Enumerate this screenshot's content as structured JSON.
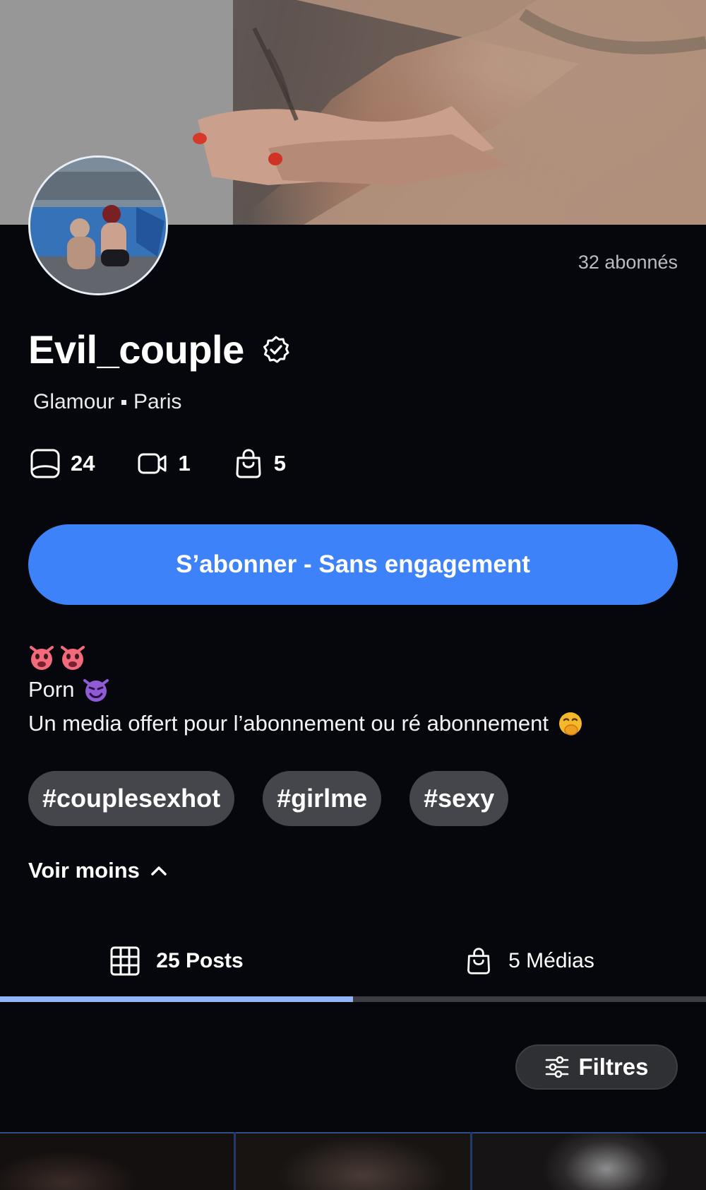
{
  "profile": {
    "subscribers": "32 abonnés",
    "name": "Evil_couple",
    "category": "Glamour",
    "location": "Paris",
    "verified": true
  },
  "stats": {
    "photos": "24",
    "videos": "1",
    "shop": "5"
  },
  "subscribe_button": {
    "label": "S’abonner - Sans engagement"
  },
  "bio": {
    "line2_text": "Porn",
    "line3_text": "Un media offert pour l’abonnement ou ré abonnement"
  },
  "tags": [
    "#couplesexhot",
    "#girlme",
    "#sexy"
  ],
  "see_less": {
    "label": "Voir moins"
  },
  "tabs": [
    {
      "label": "25 Posts",
      "icon": "grid-icon",
      "active": true
    },
    {
      "label": "5 Médias",
      "icon": "shopping-bag-icon",
      "active": false
    }
  ],
  "filters_button": {
    "label": "Filtres"
  },
  "colors": {
    "background": "#05070c",
    "accent": "#3d82f8",
    "tag_background": "#45464b",
    "tab_indicator": "#8fb5f6"
  }
}
